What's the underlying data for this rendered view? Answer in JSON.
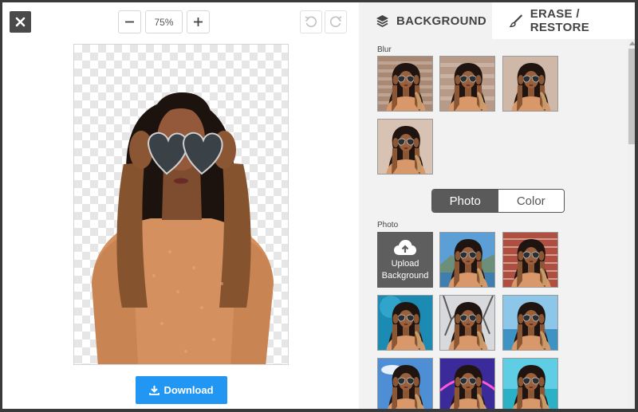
{
  "editor": {
    "zoom_value": "75%",
    "download_label": "Download"
  },
  "tabs": {
    "background_label": "BACKGROUND",
    "erase_restore_label": "ERASE / RESTORE"
  },
  "blur": {
    "section_label": "Blur",
    "thumbnails": [
      "blur-1",
      "blur-2",
      "blur-3",
      "blur-4"
    ]
  },
  "segment": {
    "photo_label": "Photo",
    "color_label": "Color",
    "selected": "Photo"
  },
  "photo": {
    "section_label": "Photo",
    "upload_line1": "Upload",
    "upload_line2": "Background",
    "thumbnails": [
      "city-coast",
      "brick-wall",
      "teal-blue",
      "tree-branches",
      "sea-sky",
      "sky-clouds",
      "purple-neon",
      "tropical-beach"
    ]
  },
  "colors": {
    "accent": "#2196f3",
    "dark": "#4a4a4a",
    "panel": "#f2f2f2"
  }
}
